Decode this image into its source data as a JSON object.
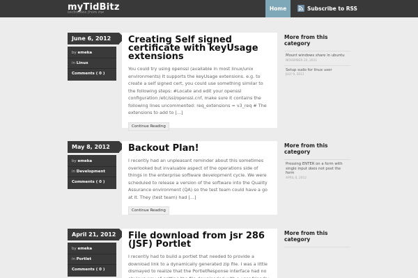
{
  "site": {
    "title": "myTidBitz",
    "tagline": "technotes from me"
  },
  "nav": {
    "home": "Home",
    "subscribe": "Subscribe to RSS"
  },
  "posts": [
    {
      "date": "June 6, 2012",
      "author_label": "by",
      "author": "emeka",
      "category_label": "in",
      "category": "Linux",
      "comments": "Comments ( 0 )",
      "title": "Creating Self signed certificate with keyUsage extensions",
      "excerpt": "You could try using openssl (available in most linux/unix environments) It supports the keyUsage extensions. e.g. to create a self signed cert, you could use something similar to the following steps: #Locate and edit your openssl configuration /etc/ssl/openssl.cnf, make sure it contains the following lines uncommented: req_extensions = v3_req # The extensions to add to [...]",
      "continue": "Continue Reading",
      "sidebar_title": "More from this category",
      "sidebar_items": [
        {
          "title": "Mount windows share in ubuntu",
          "date": "NOVEMBER 20, 2011"
        },
        {
          "title": "Setup sudo for linux user",
          "date": "JULY 9, 2011"
        }
      ]
    },
    {
      "date": "May 8, 2012",
      "author_label": "by",
      "author": "emeka",
      "category_label": "in",
      "category": "Development",
      "comments": "Comments ( 0 )",
      "title": "Backout Plan!",
      "excerpt": "I recently had an unpleasant reminder about this sometimes overlooked but invaluable aspect of the operations side of things in the enterprise software development cycle. We were scheduled to release a version of the software into the Quality Assurance environment (QA) so the test team could have a go at it. They (test team) had [...]",
      "continue": "Continue Reading",
      "sidebar_title": "More from this category",
      "sidebar_items": [
        {
          "title": "Pressing ENTER on a form with single input does not post the form",
          "date": "APRIL 6, 2012"
        }
      ]
    },
    {
      "date": "April 21, 2012",
      "author_label": "by",
      "author": "emeka",
      "category_label": "in",
      "category": "Portlet",
      "comments": "Comments ( 0 )",
      "title": "File download from jsr 286 (JSF) Portlet",
      "excerpt": "I recently had to build a portlet that needed to provide a download link to a dynamically generated zip file. I was a little dismayed to realize that the PortletResponse interface had no obvious way of getting the file downloaded with a user friendly name. It's more",
      "continue": "",
      "sidebar_title": "More from this category",
      "sidebar_items": []
    }
  ]
}
